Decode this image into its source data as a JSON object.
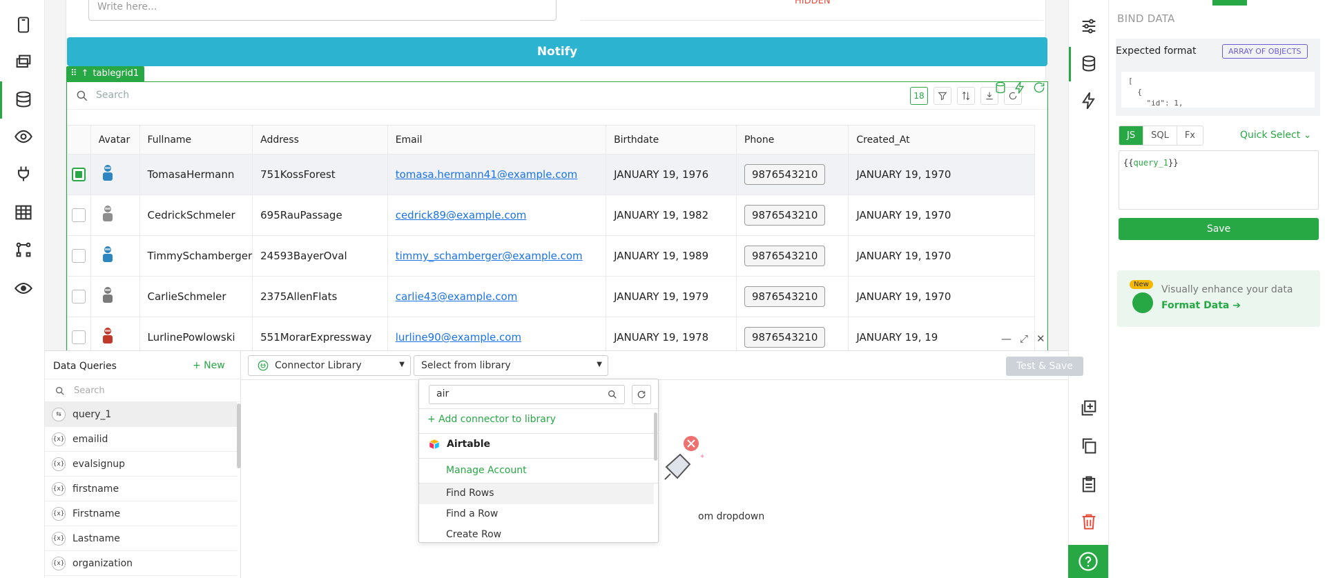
{
  "canvas": {
    "write_placeholder": "Write here...",
    "hidden_label": "HIDDEN",
    "notify_label": "Notify",
    "grid_tag": "tablegrid1",
    "grid_search": "Search",
    "grid_count": "18",
    "columns": [
      "Avatar",
      "Fullname",
      "Address",
      "Email",
      "Birthdate",
      "Phone",
      "Created_At"
    ],
    "rows": [
      {
        "fullname": "TomasaHermann",
        "address": "751KossForest",
        "email": "tomasa.hermann41@example.com",
        "birthdate": "JANUARY 19, 1976",
        "phone": "9876543210",
        "created": "JANUARY 19, 1970",
        "selected": true,
        "avatar_color": "#2e86c1"
      },
      {
        "fullname": "CedrickSchmeler",
        "address": "695RauPassage",
        "email": "cedrick89@example.com",
        "birthdate": "JANUARY 19, 1982",
        "phone": "9876543210",
        "created": "JANUARY 19, 1970",
        "selected": false,
        "avatar_color": "#8e8e8e"
      },
      {
        "fullname": "TimmySchamberger",
        "address": "24593BayerOval",
        "email": "timmy_schamberger@example.com",
        "birthdate": "JANUARY 19, 1989",
        "phone": "9876543210",
        "created": "JANUARY 19, 1970",
        "selected": false,
        "avatar_color": "#2e86c1"
      },
      {
        "fullname": "CarlieSchmeler",
        "address": "2375AllenFlats",
        "email": "carlie43@example.com",
        "birthdate": "JANUARY 19, 1979",
        "phone": "9876543210",
        "created": "JANUARY 19, 1970",
        "selected": false,
        "avatar_color": "#7a7a7a"
      },
      {
        "fullname": "LurlinePowlowski",
        "address": "551MorarExpressway",
        "email": "lurline90@example.com",
        "birthdate": "JANUARY 19, 1978",
        "phone": "9876543210",
        "created": "JANUARY 19, 19",
        "selected": false,
        "avatar_color": "#c0392b"
      }
    ]
  },
  "bind": {
    "title": "BIND DATA",
    "expected_format": "Expected format",
    "format_badge": "ARRAY OF OBJECTS",
    "code_preview": "[\n  {\n    \"id\": 1,",
    "tabs": [
      "JS",
      "SQL",
      "Fx"
    ],
    "active_tab": "JS",
    "quick_select": "Quick Select",
    "editor_prefix": "{{",
    "editor_value": "query_1",
    "editor_suffix": "}}",
    "save": "Save",
    "new_badge": "New",
    "enhance_text": "Visually enhance your data",
    "format_link": "Format Data ➔"
  },
  "queries": {
    "title": "Data Queries",
    "new": "+ New",
    "search": "Search",
    "items": [
      {
        "name": "query_1",
        "badge": "⇆",
        "active": true
      },
      {
        "name": "emailid",
        "badge": "{x}",
        "active": false
      },
      {
        "name": "evalsignup",
        "badge": "{x}",
        "active": false
      },
      {
        "name": "firstname",
        "badge": "{x}",
        "active": false
      },
      {
        "name": "Firstname",
        "badge": "{x}",
        "active": false
      },
      {
        "name": "Lastname",
        "badge": "{x}",
        "active": false
      },
      {
        "name": "organization",
        "badge": "{x}",
        "active": false
      }
    ]
  },
  "editor": {
    "connector_select": "Connector Library",
    "library_select": "Select from library",
    "test_save": "Test & Save",
    "empty_text": "om dropdown"
  },
  "dropdown": {
    "search_value": "air",
    "add_connector": "+ Add connector to library",
    "provider": "Airtable",
    "manage": "Manage Account",
    "options": [
      "Find Rows",
      "Find a Row",
      "Create Row"
    ],
    "highlighted": "Find Rows"
  },
  "colors": {
    "accent": "#28a745",
    "notify": "#2bb3d0",
    "link": "#1a73e8",
    "badge": "#6b5cd6"
  }
}
